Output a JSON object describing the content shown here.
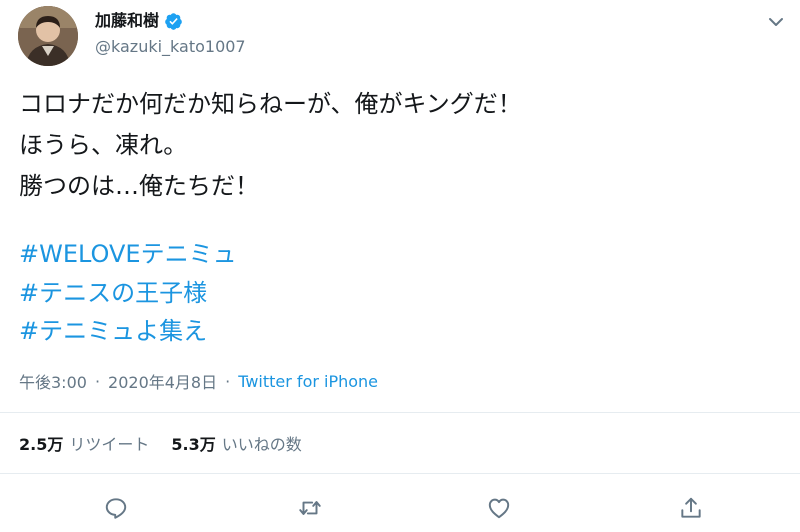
{
  "author": {
    "display_name": "加藤和樹",
    "handle": "@kazuki_kato1007",
    "verified": true
  },
  "tweet": {
    "lines": [
      "コロナだか何だか知らねーが、俺がキングだ！",
      "ほうら、凍れ。",
      "勝つのは…俺たちだ！"
    ],
    "hashtags": [
      "#WELOVEテニミュ",
      "#テニスの王子様",
      "#テニミュよ集え"
    ]
  },
  "meta": {
    "time": "午後3:00",
    "date": "2020年4月8日",
    "separator": "·",
    "source": "Twitter for iPhone"
  },
  "stats": {
    "retweets_count": "2.5万",
    "retweets_label": "リツイート",
    "likes_count": "5.3万",
    "likes_label": "いいねの数"
  },
  "icons": {
    "verified": "verified-badge-icon",
    "caret": "chevron-down-icon",
    "reply": "reply-icon",
    "retweet": "retweet-icon",
    "like": "heart-icon",
    "share": "share-icon"
  },
  "colors": {
    "link": "#1b95e0",
    "secondary": "#657786",
    "divider": "#e6ecf0",
    "verified": "#1da1f2"
  }
}
